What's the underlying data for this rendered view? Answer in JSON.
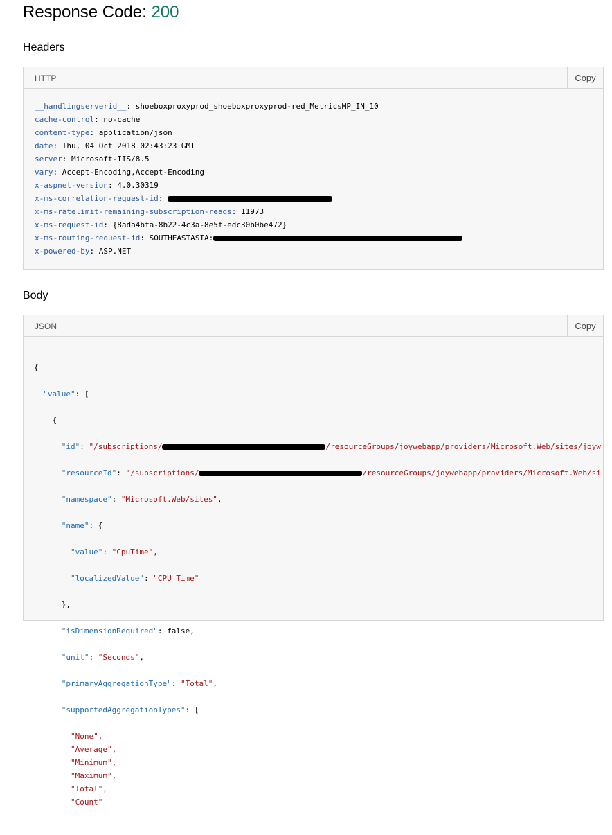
{
  "response": {
    "label": "Response Code:",
    "code": "200"
  },
  "headers_section": {
    "heading": "Headers",
    "lang": "HTTP",
    "copy": "Copy",
    "lines": [
      {
        "k": "__handlingserverid__",
        "v": "shoeboxproxyprod_shoeboxproxyprod-red_MetricsMP_IN_10"
      },
      {
        "k": "cache-control",
        "v": "no-cache"
      },
      {
        "k": "content-type",
        "v": "application/json"
      },
      {
        "k": "date",
        "v": "Thu, 04 Oct 2018 02:43:23 GMT"
      },
      {
        "k": "server",
        "v": "Microsoft-IIS/8.5"
      },
      {
        "k": "vary",
        "v": "Accept-Encoding,Accept-Encoding"
      },
      {
        "k": "x-aspnet-version",
        "v": "4.0.30319"
      },
      {
        "k": "x-ms-correlation-request-id",
        "v": "",
        "redacted": true
      },
      {
        "k": "x-ms-ratelimit-remaining-subscription-reads",
        "v": "11973"
      },
      {
        "k": "x-ms-request-id",
        "v": "{8ada4bfa-8b22-4c3a-8e5f-edc30b0be472}"
      },
      {
        "k": "x-ms-routing-request-id",
        "v": "SOUTHEASTASIA:",
        "redacted": true
      },
      {
        "k": "x-powered-by",
        "v": "ASP.NET"
      }
    ]
  },
  "body_section": {
    "heading": "Body",
    "lang": "JSON",
    "copy": "Copy",
    "json": {
      "open": "{",
      "value_key": "\"value\"",
      "open_arr": ": [",
      "open_obj": "{",
      "id_key": "\"id\"",
      "id_prefix": "\"/subscriptions/",
      "id_suffix": "/resourceGroups/joywebapp/providers/Microsoft.Web/sites/joyw",
      "resourceId_key": "\"resourceId\"",
      "resourceId_prefix": "\"/subscriptions/",
      "resourceId_suffix": "/resourceGroups/joywebapp/providers/Microsoft.Web/si",
      "namespace_key": "\"namespace\"",
      "namespace_val": "\"Microsoft.Web/sites\"",
      "name_key": "\"name\"",
      "name_open": ": {",
      "name_value_key": "\"value\"",
      "name_value_val": "\"CpuTime\"",
      "localized_key": "\"localizedValue\"",
      "localized_val": "\"CPU Time\"",
      "name_close": "},",
      "isdim_key": "\"isDimensionRequired\"",
      "isdim_val": "false",
      "unit_key": "\"unit\"",
      "unit_val": "\"Seconds\"",
      "primary_key": "\"primaryAggregationType\"",
      "primary_val": "\"Total\"",
      "supported_key": "\"supportedAggregationTypes\"",
      "supported_open": ": [",
      "agg_types": [
        "\"None\",",
        "\"Average\",",
        "\"Minimum\",",
        "\"Maximum\",",
        "\"Total\",",
        "\"Count\""
      ]
    }
  }
}
